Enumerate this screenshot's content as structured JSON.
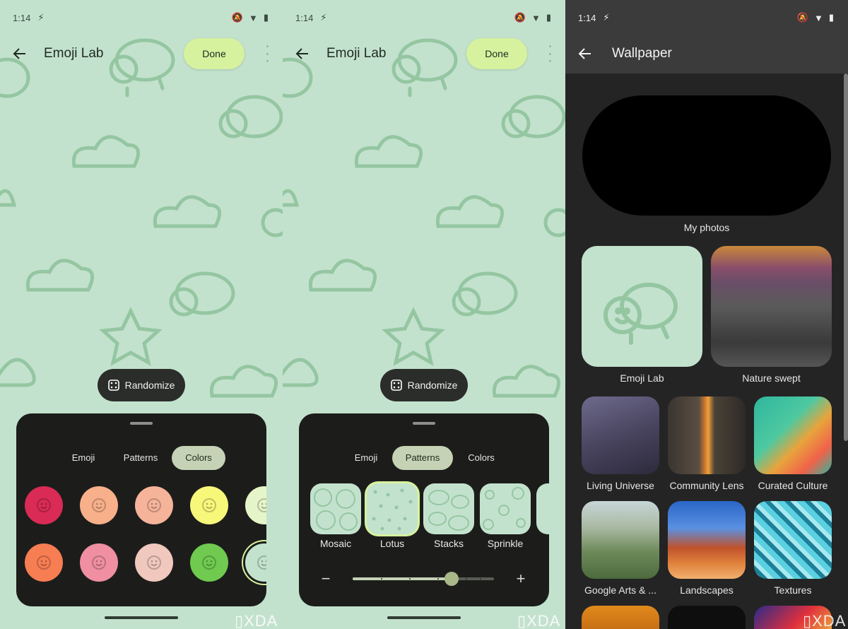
{
  "status": {
    "time": "1:14"
  },
  "emoji_lab": {
    "title": "Emoji Lab",
    "done_label": "Done",
    "randomize_label": "Randomize",
    "tabs": [
      "Emoji",
      "Patterns",
      "Colors"
    ]
  },
  "panel1": {
    "active_tab": "Colors",
    "swatch_colors": [
      "#d92b55",
      "#f7b08a",
      "#f5b39a",
      "#f7f77a",
      "#e6f5c9",
      "#f77d52",
      "#ef8fa1",
      "#f0c8bd",
      "#6fca4f",
      "#c3e2cd"
    ],
    "selected_swatch_index": 9
  },
  "panel2": {
    "active_tab": "Patterns",
    "patterns": [
      "Mosaic",
      "Lotus",
      "Stacks",
      "Sprinkle"
    ],
    "selected_pattern": "Lotus",
    "slider": {
      "value": 0.7,
      "minus": "−",
      "plus": "+"
    }
  },
  "wallpaper": {
    "title": "Wallpaper",
    "my_photos": "My photos",
    "categories": [
      {
        "label": "Emoji Lab"
      },
      {
        "label": "Nature swept"
      },
      {
        "label": "Living Universe"
      },
      {
        "label": "Community Lens"
      },
      {
        "label": "Curated Culture"
      },
      {
        "label": "Google Arts & ..."
      },
      {
        "label": "Landscapes"
      },
      {
        "label": "Textures"
      }
    ]
  },
  "watermark": "XDA",
  "colors": {
    "accent": "#d6f29e",
    "mint": "#c3e2cd",
    "sheet": "#1c1d1b",
    "chip": "#c6d2b5"
  }
}
